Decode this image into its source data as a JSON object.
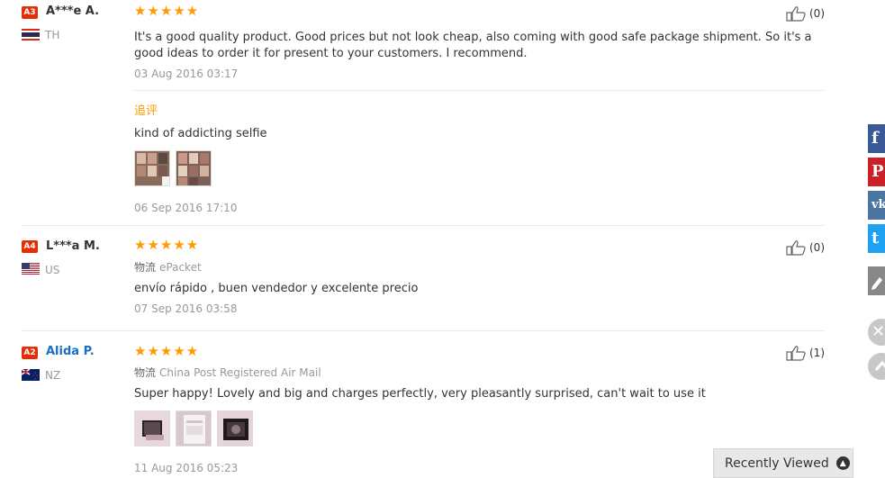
{
  "reviews": [
    {
      "level": "A3",
      "name": "A***e A.",
      "country": "TH",
      "stars": "★★★★★",
      "likes": "(0)",
      "text": "It's a good quality product. Good prices but not look cheap, also coming with good safe package shipment. So it's a good ideas to order it for present to your customers. I recommend.",
      "date": "03 Aug 2016 03:17",
      "additional": {
        "label": "追评",
        "text": "kind of addicting selfie",
        "date": "06 Sep 2016 17:10"
      }
    },
    {
      "level": "A4",
      "name": "L***a M.",
      "country": "US",
      "stars": "★★★★★",
      "likes": "(0)",
      "logistics_label": "物流",
      "logistics": "ePacket",
      "text": "envío rápido , buen vendedor y excelente precio",
      "date": "07 Sep 2016 03:58"
    },
    {
      "level": "A2",
      "name": "Alida P.",
      "country": "NZ",
      "stars": "★★★★★",
      "likes": "(1)",
      "logistics_label": "物流",
      "logistics": "China Post Registered Air Mail",
      "text": "Super happy! Lovely and big and charges perfectly, very pleasantly surprised, can't wait to use it",
      "date": "11 Aug 2016 05:23"
    }
  ],
  "share": {
    "facebook": "f",
    "pinterest": "P",
    "vk": "vk",
    "twitter": "t",
    "colors": {
      "facebook": "#3b5998",
      "pinterest": "#cb2027",
      "vk": "#4c75a3",
      "twitter": "#1da1f2",
      "edit": "#888888"
    }
  },
  "recently_viewed": {
    "label": "Recently Viewed"
  },
  "colors": {
    "badge": "#e62e04",
    "stars": "#ff9a00",
    "link": "#1a6fc4",
    "muted": "#999999"
  }
}
